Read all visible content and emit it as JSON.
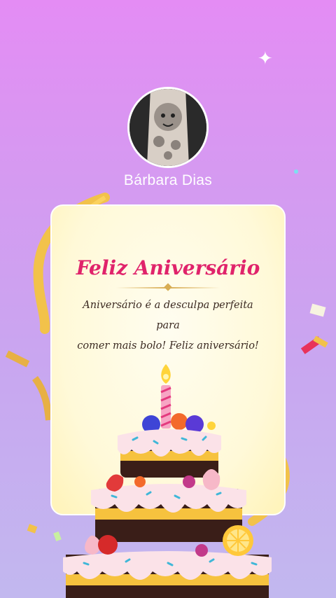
{
  "profile": {
    "name": "Bárbara Dias",
    "avatar_icon": "avatar-photo"
  },
  "card": {
    "title": "Feliz Aniversário",
    "message_line1": "Aniversário é a desculpa perfeita para",
    "message_line2": "comer mais bolo! Feliz aniversário!"
  },
  "decor": {
    "sparkle_glyph": "✦",
    "cake_icon": "birthday-cake-icon"
  },
  "colors": {
    "title": "#e0236b",
    "accent": "#d8ad54",
    "card_bg": "#fff9d8"
  }
}
